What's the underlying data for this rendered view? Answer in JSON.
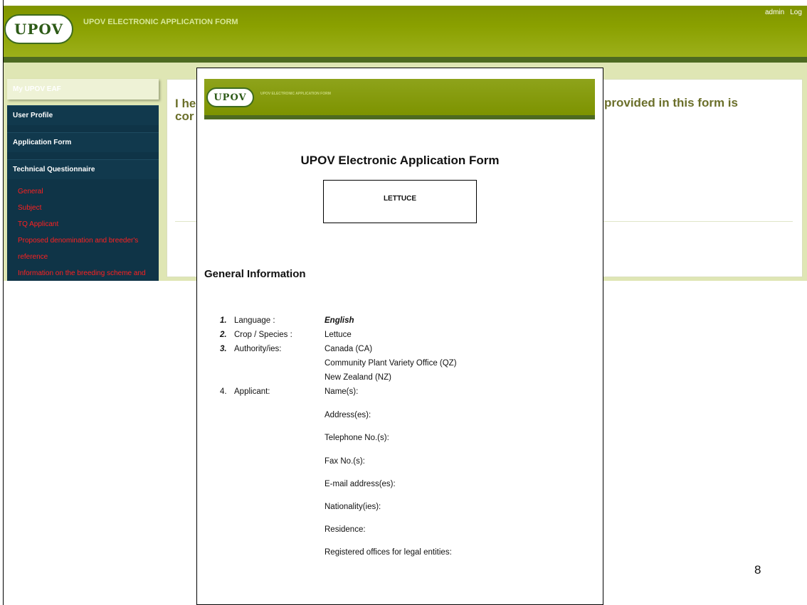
{
  "app": {
    "logo": "UPOV",
    "title": "UPOV ELECTRONIC APPLICATION FORM",
    "user": "admin",
    "logout": "Log"
  },
  "sidebar": {
    "top": "My UPOV EAF",
    "items": [
      {
        "label": "User Profile"
      },
      {
        "label": "Application Form"
      },
      {
        "label": "Technical Questionnaire"
      }
    ],
    "subitems": [
      "General",
      "Subject",
      "TQ Applicant",
      "Proposed denomination and breeder's",
      "reference",
      "Information on the breeding scheme and"
    ]
  },
  "main": {
    "decl_left_1": "I he",
    "decl_left_2": "cor",
    "decl_right": "provided in this form is"
  },
  "doc": {
    "logo": "UPOV",
    "header_title": "UPOV ELECTRONIC APPLICATION FORM",
    "title": "UPOV Electronic Application Form",
    "crop": "LETTUCE",
    "section": "General Information",
    "fields": {
      "n1": "1.",
      "l1": "Language :",
      "v1": "English",
      "n2": "2.",
      "l2": "Crop / Species :",
      "v2": "Lettuce",
      "n3": "3.",
      "l3": "Authority/ies:",
      "authorities": [
        "Canada (CA)",
        "Community Plant Variety Office (QZ)",
        "New Zealand (NZ)"
      ],
      "n4": "4.",
      "l4": "Applicant:"
    },
    "applicant_fields": [
      "Name(s):",
      "Address(es):",
      "Telephone No.(s):",
      "Fax No.(s):",
      "E-mail address(es):",
      "Nationality(ies):",
      "Residence:",
      "Registered offices for legal entities:"
    ]
  },
  "slide": {
    "page_number": "8"
  },
  "colors": {
    "header_green": "#8aa000",
    "nav_dark": "#0f3447",
    "nav_sub_red": "#ff2020",
    "decl_text": "#6b6f2a"
  }
}
